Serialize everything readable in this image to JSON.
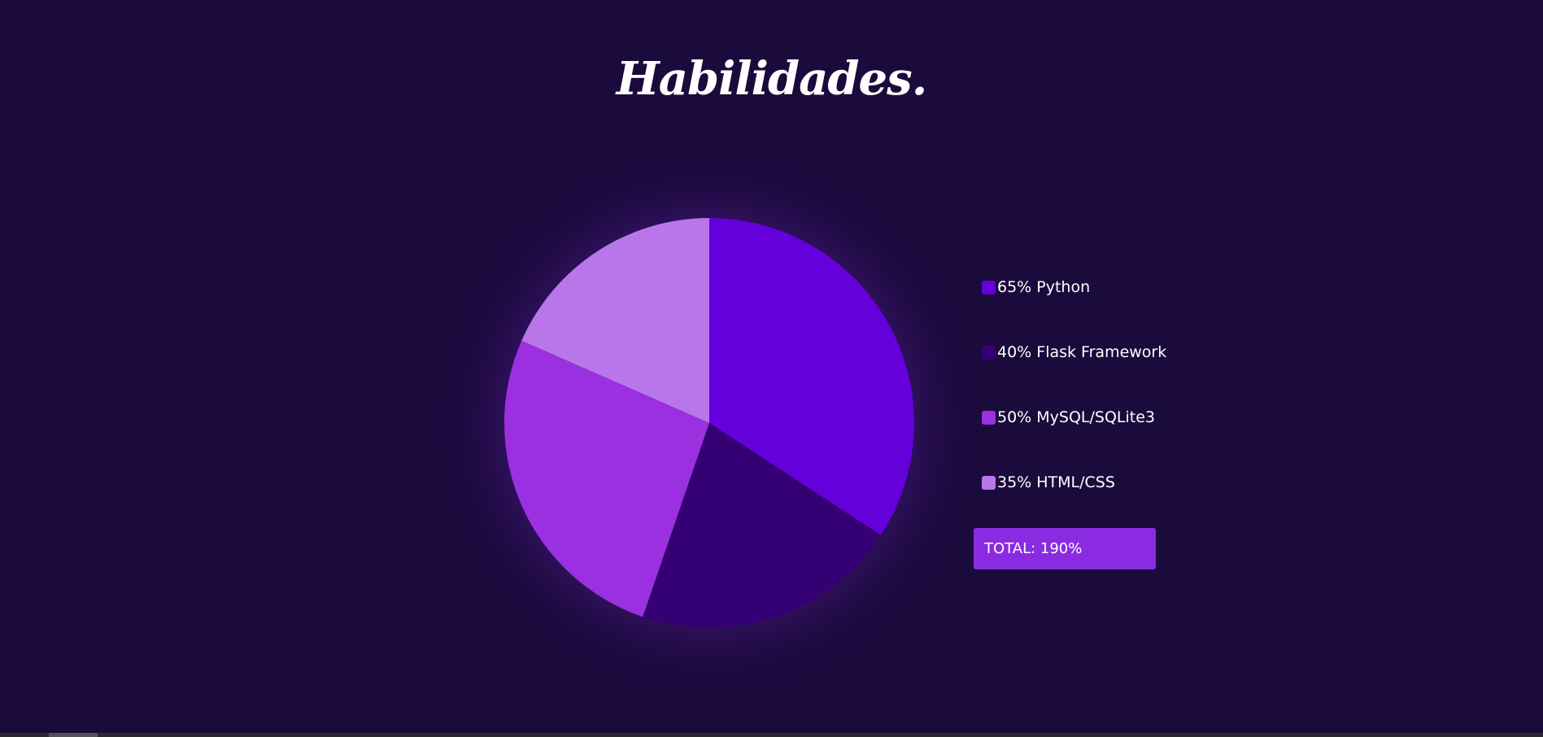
{
  "page": {
    "title": "Habilidades."
  },
  "chart_data": {
    "type": "pie",
    "categories": [
      "Python",
      "Flask Framework",
      "MySQL/SQLite3",
      "HTML/CSS"
    ],
    "values": [
      65,
      40,
      50,
      35
    ],
    "labels": [
      "65% Python",
      "40% Flask Framework",
      "50% MySQL/SQLite3",
      "35% HTML/CSS"
    ],
    "colors": [
      "#6400d9",
      "#350073",
      "#9a30df",
      "#b876ea"
    ],
    "legend_placement": "right",
    "total_label": "TOTAL: 190%"
  }
}
